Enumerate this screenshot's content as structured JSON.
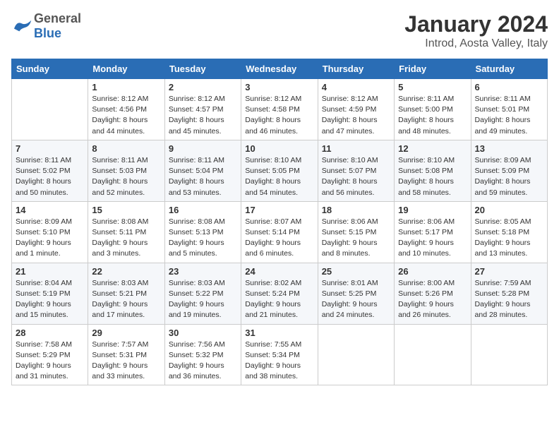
{
  "logo": {
    "general": "General",
    "blue": "Blue"
  },
  "title": "January 2024",
  "subtitle": "Introd, Aosta Valley, Italy",
  "days_of_week": [
    "Sunday",
    "Monday",
    "Tuesday",
    "Wednesday",
    "Thursday",
    "Friday",
    "Saturday"
  ],
  "weeks": [
    [
      {
        "num": "",
        "sunrise": "",
        "sunset": "",
        "daylight": ""
      },
      {
        "num": "1",
        "sunrise": "Sunrise: 8:12 AM",
        "sunset": "Sunset: 4:56 PM",
        "daylight": "Daylight: 8 hours and 44 minutes."
      },
      {
        "num": "2",
        "sunrise": "Sunrise: 8:12 AM",
        "sunset": "Sunset: 4:57 PM",
        "daylight": "Daylight: 8 hours and 45 minutes."
      },
      {
        "num": "3",
        "sunrise": "Sunrise: 8:12 AM",
        "sunset": "Sunset: 4:58 PM",
        "daylight": "Daylight: 8 hours and 46 minutes."
      },
      {
        "num": "4",
        "sunrise": "Sunrise: 8:12 AM",
        "sunset": "Sunset: 4:59 PM",
        "daylight": "Daylight: 8 hours and 47 minutes."
      },
      {
        "num": "5",
        "sunrise": "Sunrise: 8:11 AM",
        "sunset": "Sunset: 5:00 PM",
        "daylight": "Daylight: 8 hours and 48 minutes."
      },
      {
        "num": "6",
        "sunrise": "Sunrise: 8:11 AM",
        "sunset": "Sunset: 5:01 PM",
        "daylight": "Daylight: 8 hours and 49 minutes."
      }
    ],
    [
      {
        "num": "7",
        "sunrise": "Sunrise: 8:11 AM",
        "sunset": "Sunset: 5:02 PM",
        "daylight": "Daylight: 8 hours and 50 minutes."
      },
      {
        "num": "8",
        "sunrise": "Sunrise: 8:11 AM",
        "sunset": "Sunset: 5:03 PM",
        "daylight": "Daylight: 8 hours and 52 minutes."
      },
      {
        "num": "9",
        "sunrise": "Sunrise: 8:11 AM",
        "sunset": "Sunset: 5:04 PM",
        "daylight": "Daylight: 8 hours and 53 minutes."
      },
      {
        "num": "10",
        "sunrise": "Sunrise: 8:10 AM",
        "sunset": "Sunset: 5:05 PM",
        "daylight": "Daylight: 8 hours and 54 minutes."
      },
      {
        "num": "11",
        "sunrise": "Sunrise: 8:10 AM",
        "sunset": "Sunset: 5:07 PM",
        "daylight": "Daylight: 8 hours and 56 minutes."
      },
      {
        "num": "12",
        "sunrise": "Sunrise: 8:10 AM",
        "sunset": "Sunset: 5:08 PM",
        "daylight": "Daylight: 8 hours and 58 minutes."
      },
      {
        "num": "13",
        "sunrise": "Sunrise: 8:09 AM",
        "sunset": "Sunset: 5:09 PM",
        "daylight": "Daylight: 8 hours and 59 minutes."
      }
    ],
    [
      {
        "num": "14",
        "sunrise": "Sunrise: 8:09 AM",
        "sunset": "Sunset: 5:10 PM",
        "daylight": "Daylight: 9 hours and 1 minute."
      },
      {
        "num": "15",
        "sunrise": "Sunrise: 8:08 AM",
        "sunset": "Sunset: 5:11 PM",
        "daylight": "Daylight: 9 hours and 3 minutes."
      },
      {
        "num": "16",
        "sunrise": "Sunrise: 8:08 AM",
        "sunset": "Sunset: 5:13 PM",
        "daylight": "Daylight: 9 hours and 5 minutes."
      },
      {
        "num": "17",
        "sunrise": "Sunrise: 8:07 AM",
        "sunset": "Sunset: 5:14 PM",
        "daylight": "Daylight: 9 hours and 6 minutes."
      },
      {
        "num": "18",
        "sunrise": "Sunrise: 8:06 AM",
        "sunset": "Sunset: 5:15 PM",
        "daylight": "Daylight: 9 hours and 8 minutes."
      },
      {
        "num": "19",
        "sunrise": "Sunrise: 8:06 AM",
        "sunset": "Sunset: 5:17 PM",
        "daylight": "Daylight: 9 hours and 10 minutes."
      },
      {
        "num": "20",
        "sunrise": "Sunrise: 8:05 AM",
        "sunset": "Sunset: 5:18 PM",
        "daylight": "Daylight: 9 hours and 13 minutes."
      }
    ],
    [
      {
        "num": "21",
        "sunrise": "Sunrise: 8:04 AM",
        "sunset": "Sunset: 5:19 PM",
        "daylight": "Daylight: 9 hours and 15 minutes."
      },
      {
        "num": "22",
        "sunrise": "Sunrise: 8:03 AM",
        "sunset": "Sunset: 5:21 PM",
        "daylight": "Daylight: 9 hours and 17 minutes."
      },
      {
        "num": "23",
        "sunrise": "Sunrise: 8:03 AM",
        "sunset": "Sunset: 5:22 PM",
        "daylight": "Daylight: 9 hours and 19 minutes."
      },
      {
        "num": "24",
        "sunrise": "Sunrise: 8:02 AM",
        "sunset": "Sunset: 5:24 PM",
        "daylight": "Daylight: 9 hours and 21 minutes."
      },
      {
        "num": "25",
        "sunrise": "Sunrise: 8:01 AM",
        "sunset": "Sunset: 5:25 PM",
        "daylight": "Daylight: 9 hours and 24 minutes."
      },
      {
        "num": "26",
        "sunrise": "Sunrise: 8:00 AM",
        "sunset": "Sunset: 5:26 PM",
        "daylight": "Daylight: 9 hours and 26 minutes."
      },
      {
        "num": "27",
        "sunrise": "Sunrise: 7:59 AM",
        "sunset": "Sunset: 5:28 PM",
        "daylight": "Daylight: 9 hours and 28 minutes."
      }
    ],
    [
      {
        "num": "28",
        "sunrise": "Sunrise: 7:58 AM",
        "sunset": "Sunset: 5:29 PM",
        "daylight": "Daylight: 9 hours and 31 minutes."
      },
      {
        "num": "29",
        "sunrise": "Sunrise: 7:57 AM",
        "sunset": "Sunset: 5:31 PM",
        "daylight": "Daylight: 9 hours and 33 minutes."
      },
      {
        "num": "30",
        "sunrise": "Sunrise: 7:56 AM",
        "sunset": "Sunset: 5:32 PM",
        "daylight": "Daylight: 9 hours and 36 minutes."
      },
      {
        "num": "31",
        "sunrise": "Sunrise: 7:55 AM",
        "sunset": "Sunset: 5:34 PM",
        "daylight": "Daylight: 9 hours and 38 minutes."
      },
      {
        "num": "",
        "sunrise": "",
        "sunset": "",
        "daylight": ""
      },
      {
        "num": "",
        "sunrise": "",
        "sunset": "",
        "daylight": ""
      },
      {
        "num": "",
        "sunrise": "",
        "sunset": "",
        "daylight": ""
      }
    ]
  ]
}
